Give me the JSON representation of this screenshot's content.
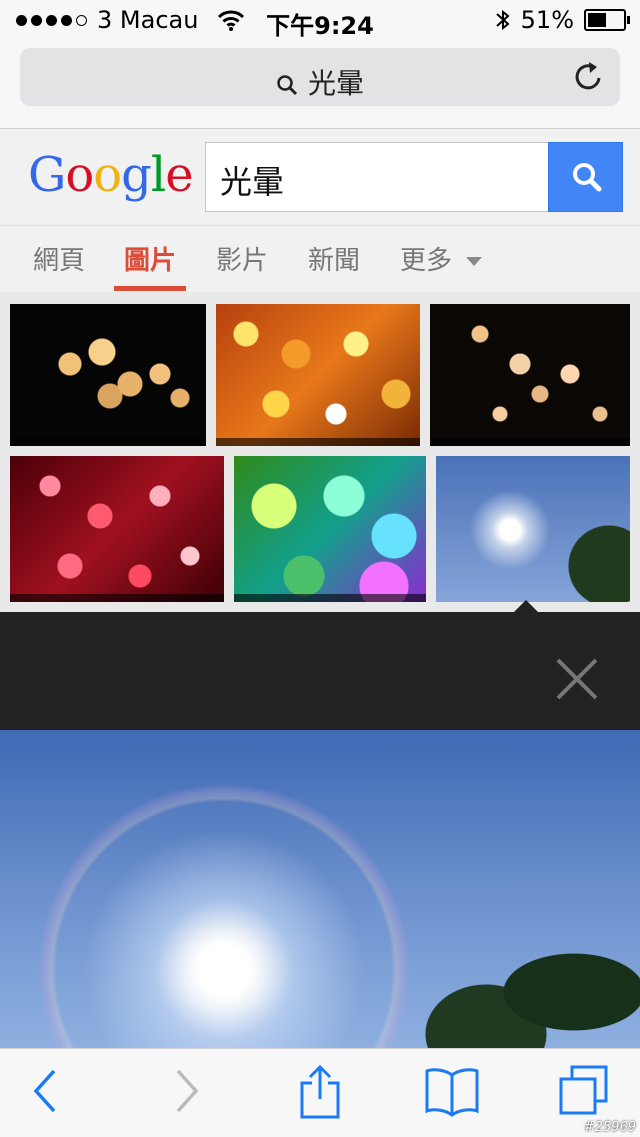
{
  "status": {
    "carrier": "3 Macau",
    "time": "下午9:24",
    "battery": "51%"
  },
  "browser": {
    "query": "光暈"
  },
  "google": {
    "logo_letters": [
      {
        "ch": "G",
        "color": "#3369e8"
      },
      {
        "ch": "o",
        "color": "#d50f25"
      },
      {
        "ch": "o",
        "color": "#eeb211"
      },
      {
        "ch": "g",
        "color": "#3369e8"
      },
      {
        "ch": "l",
        "color": "#009925"
      },
      {
        "ch": "e",
        "color": "#d50f25"
      }
    ],
    "search_value": "光暈"
  },
  "tabs": [
    {
      "label": "網頁"
    },
    {
      "label": "圖片",
      "active": true
    },
    {
      "label": "影片"
    },
    {
      "label": "新聞"
    },
    {
      "label": "更多"
    }
  ],
  "colors": {
    "accent": "#dd4b39",
    "search_button": "#4285f4"
  },
  "icons": [
    "search-icon",
    "reload-icon",
    "close-icon",
    "back-icon",
    "forward-icon",
    "share-icon",
    "bookmarks-icon",
    "tabs-icon",
    "wifi-icon",
    "bluetooth-icon",
    "battery-icon"
  ],
  "watermark": "#25969"
}
